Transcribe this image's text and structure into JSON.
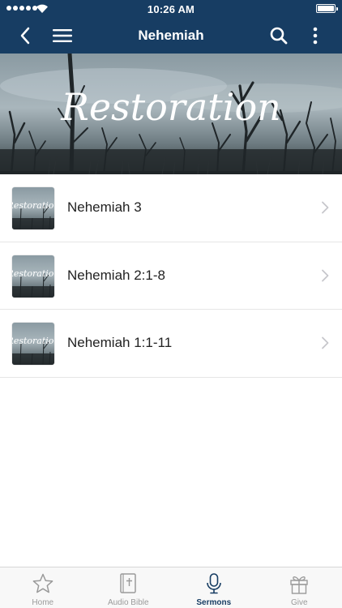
{
  "status_bar": {
    "time": "10:26 AM"
  },
  "header": {
    "title": "Nehemiah"
  },
  "hero": {
    "script_text": "Restoration"
  },
  "sermons": [
    {
      "title": "Nehemiah 3"
    },
    {
      "title": "Nehemiah 2:1-8"
    },
    {
      "title": "Nehemiah 1:1-11"
    }
  ],
  "tabs": [
    {
      "label": "Home",
      "icon": "star-icon",
      "active": false
    },
    {
      "label": "Audio Bible",
      "icon": "bible-icon",
      "active": false
    },
    {
      "label": "Sermons",
      "icon": "microphone-icon",
      "active": true
    },
    {
      "label": "Give",
      "icon": "gift-icon",
      "active": false
    }
  ],
  "colors": {
    "nav_bg": "#173d63",
    "active_tab": "#173d63",
    "inactive_tab": "#9a9a9a"
  }
}
